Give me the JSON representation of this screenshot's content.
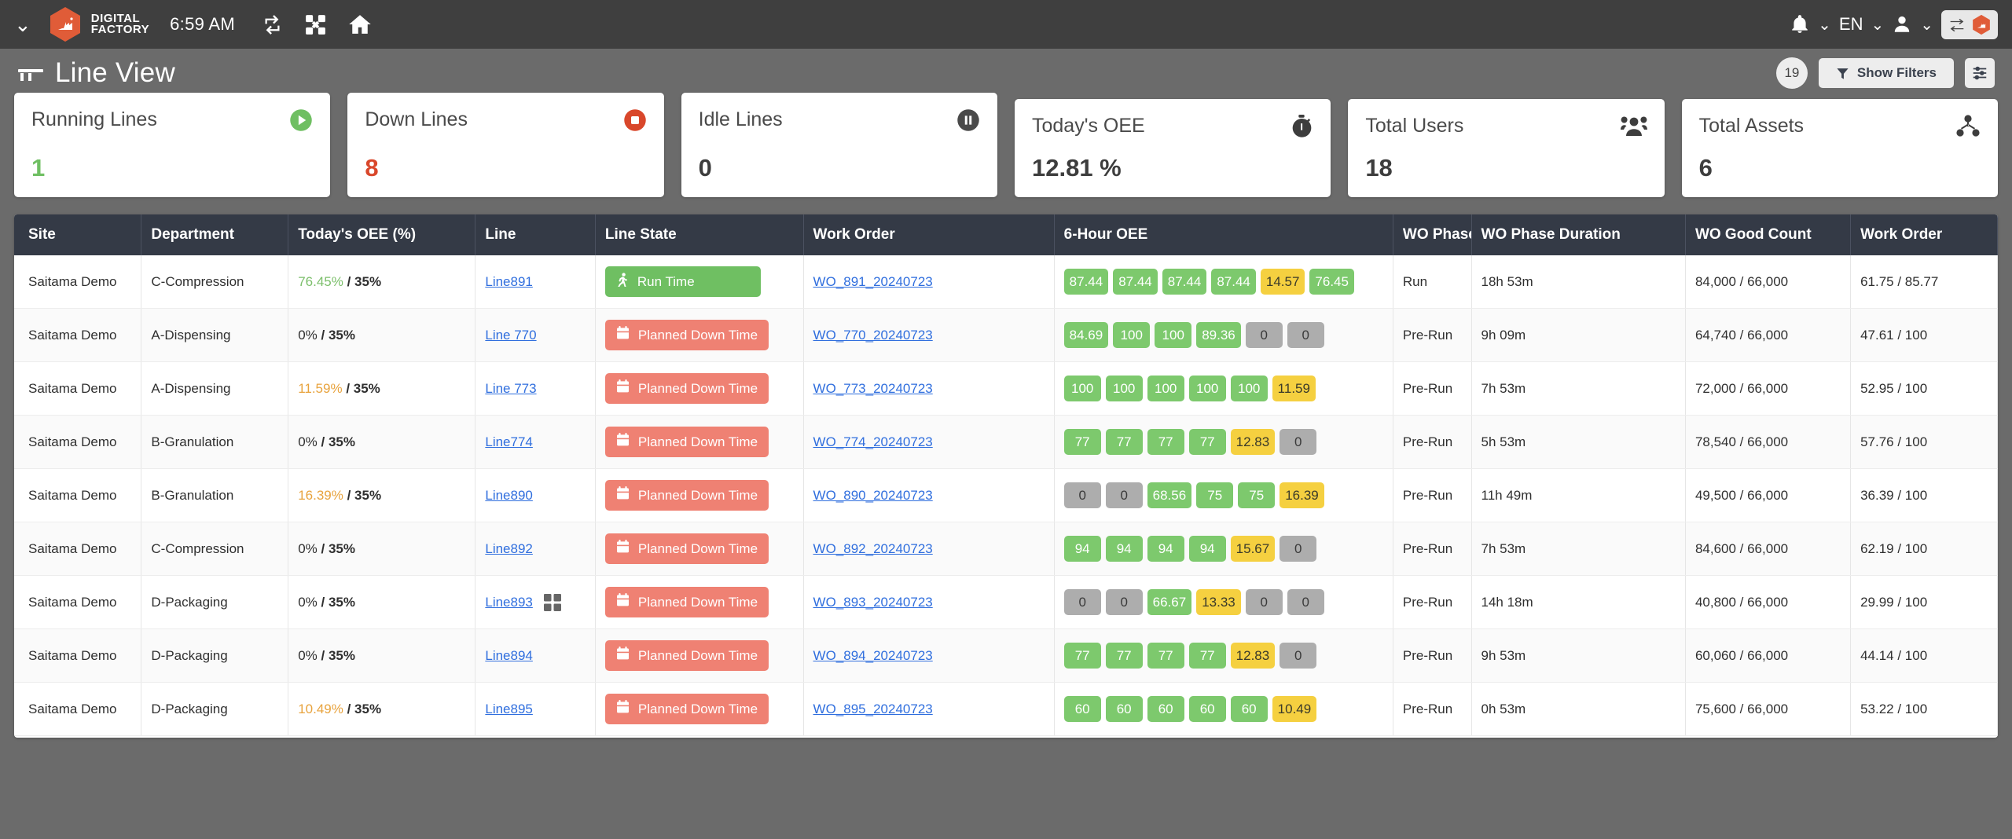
{
  "topnav": {
    "menu_chevron": "chevron-down",
    "brand_line1": "DIGITAL",
    "brand_line2": "FACTORY",
    "clock": "6:59 AM",
    "icons": [
      "refresh-icon",
      "expand-icon",
      "home-icon"
    ],
    "language": "EN",
    "notifications_icon": "bell-icon",
    "profile_icon": "user-icon",
    "switcher_icon": "swap-icon"
  },
  "page": {
    "title": "Line View",
    "title_icon": "line-view-icon",
    "count_badge": "19",
    "show_filters_label": "Show Filters",
    "filter_icon": "funnel-icon",
    "settings_icon": "sliders-icon"
  },
  "kpis": [
    {
      "title": "Running Lines",
      "value": "1",
      "icon": "play-circle-icon",
      "value_class": "green",
      "icon_color": "#6fbf62"
    },
    {
      "title": "Down Lines",
      "value": "8",
      "icon": "stop-circle-icon",
      "value_class": "red",
      "icon_color": "#d9472b"
    },
    {
      "title": "Idle Lines",
      "value": "0",
      "icon": "pause-circle-icon",
      "value_class": "",
      "icon_color": "#4a4a4a"
    },
    {
      "title": "Today's OEE",
      "value": "12.81 %",
      "icon": "stopwatch-icon",
      "value_class": "",
      "icon_color": "#3d3d3d"
    },
    {
      "title": "Total Users",
      "value": "18",
      "icon": "users-icon",
      "value_class": "",
      "icon_color": "#3d3d3d"
    },
    {
      "title": "Total Assets",
      "value": "6",
      "icon": "assets-icon",
      "value_class": "",
      "icon_color": "#3d3d3d"
    }
  ],
  "table": {
    "columns": [
      "Site",
      "Department",
      "Today's OEE (%)",
      "Line",
      "Line State",
      "Work Order",
      "6-Hour OEE",
      "WO Phase",
      "WO Phase Duration",
      "WO Good Count",
      "Work Order "
    ],
    "rows": [
      {
        "site": "Saitama Demo",
        "department": "C-Compression",
        "oee_value": "76.45%",
        "oee_class": "oee-good",
        "oee_target": "/ 35%",
        "line": "Line891",
        "has_grid_icon": false,
        "state": "Run Time",
        "state_type": "run",
        "state_icon": "runner-icon",
        "work_order": "WO_891_20240723",
        "oee6": [
          {
            "v": "87.44",
            "c": "b-green"
          },
          {
            "v": "87.44",
            "c": "b-green"
          },
          {
            "v": "87.44",
            "c": "b-green"
          },
          {
            "v": "87.44",
            "c": "b-green"
          },
          {
            "v": "14.57",
            "c": "b-yellow"
          },
          {
            "v": "76.45",
            "c": "b-green"
          }
        ],
        "phase": "Run",
        "duration": "18h 53m",
        "good_count": "84,000 / 66,000",
        "wo_last": "61.75 / 85.77"
      },
      {
        "site": "Saitama Demo",
        "department": "A-Dispensing",
        "oee_value": "0%",
        "oee_class": "oee-zero",
        "oee_target": "/ 35%",
        "line": "Line 770",
        "has_grid_icon": false,
        "state": "Planned Down Time",
        "state_type": "down",
        "state_icon": "calendar-icon",
        "work_order": "WO_770_20240723",
        "oee6": [
          {
            "v": "84.69",
            "c": "b-green"
          },
          {
            "v": "100",
            "c": "b-green"
          },
          {
            "v": "100",
            "c": "b-green"
          },
          {
            "v": "89.36",
            "c": "b-green"
          },
          {
            "v": "0",
            "c": "b-gray"
          },
          {
            "v": "0",
            "c": "b-gray"
          }
        ],
        "phase": "Pre-Run",
        "duration": "9h 09m",
        "good_count": "64,740 / 66,000",
        "wo_last": "47.61 / 100"
      },
      {
        "site": "Saitama Demo",
        "department": "A-Dispensing",
        "oee_value": "11.59%",
        "oee_class": "oee-warn",
        "oee_target": "/ 35%",
        "line": "Line 773",
        "has_grid_icon": false,
        "state": "Planned Down Time",
        "state_type": "down",
        "state_icon": "calendar-icon",
        "work_order": "WO_773_20240723",
        "oee6": [
          {
            "v": "100",
            "c": "b-green"
          },
          {
            "v": "100",
            "c": "b-green"
          },
          {
            "v": "100",
            "c": "b-green"
          },
          {
            "v": "100",
            "c": "b-green"
          },
          {
            "v": "100",
            "c": "b-green"
          },
          {
            "v": "11.59",
            "c": "b-yellow"
          }
        ],
        "phase": "Pre-Run",
        "duration": "7h 53m",
        "good_count": "72,000 / 66,000",
        "wo_last": "52.95 / 100"
      },
      {
        "site": "Saitama Demo",
        "department": "B-Granulation",
        "oee_value": "0%",
        "oee_class": "oee-zero",
        "oee_target": "/ 35%",
        "line": "Line774",
        "has_grid_icon": false,
        "state": "Planned Down Time",
        "state_type": "down",
        "state_icon": "calendar-icon",
        "work_order": "WO_774_20240723",
        "oee6": [
          {
            "v": "77",
            "c": "b-green"
          },
          {
            "v": "77",
            "c": "b-green"
          },
          {
            "v": "77",
            "c": "b-green"
          },
          {
            "v": "77",
            "c": "b-green"
          },
          {
            "v": "12.83",
            "c": "b-yellow"
          },
          {
            "v": "0",
            "c": "b-gray"
          }
        ],
        "phase": "Pre-Run",
        "duration": "5h 53m",
        "good_count": "78,540 / 66,000",
        "wo_last": "57.76 / 100"
      },
      {
        "site": "Saitama Demo",
        "department": "B-Granulation",
        "oee_value": "16.39%",
        "oee_class": "oee-warn",
        "oee_target": "/ 35%",
        "line": "Line890",
        "has_grid_icon": false,
        "state": "Planned Down Time",
        "state_type": "down",
        "state_icon": "calendar-icon",
        "work_order": "WO_890_20240723",
        "oee6": [
          {
            "v": "0",
            "c": "b-gray"
          },
          {
            "v": "0",
            "c": "b-gray"
          },
          {
            "v": "68.56",
            "c": "b-green"
          },
          {
            "v": "75",
            "c": "b-green"
          },
          {
            "v": "75",
            "c": "b-green"
          },
          {
            "v": "16.39",
            "c": "b-yellow"
          }
        ],
        "phase": "Pre-Run",
        "duration": "11h 49m",
        "good_count": "49,500 / 66,000",
        "wo_last": "36.39 / 100"
      },
      {
        "site": "Saitama Demo",
        "department": "C-Compression",
        "oee_value": "0%",
        "oee_class": "oee-zero",
        "oee_target": "/ 35%",
        "line": "Line892",
        "has_grid_icon": false,
        "state": "Planned Down Time",
        "state_type": "down",
        "state_icon": "calendar-icon",
        "work_order": "WO_892_20240723",
        "oee6": [
          {
            "v": "94",
            "c": "b-green"
          },
          {
            "v": "94",
            "c": "b-green"
          },
          {
            "v": "94",
            "c": "b-green"
          },
          {
            "v": "94",
            "c": "b-green"
          },
          {
            "v": "15.67",
            "c": "b-yellow"
          },
          {
            "v": "0",
            "c": "b-gray"
          }
        ],
        "phase": "Pre-Run",
        "duration": "7h 53m",
        "good_count": "84,600 / 66,000",
        "wo_last": "62.19 / 100"
      },
      {
        "site": "Saitama Demo",
        "department": "D-Packaging",
        "oee_value": "0%",
        "oee_class": "oee-zero",
        "oee_target": "/ 35%",
        "line": "Line893",
        "has_grid_icon": true,
        "state": "Planned Down Time",
        "state_type": "down",
        "state_icon": "calendar-icon",
        "work_order": "WO_893_20240723",
        "oee6": [
          {
            "v": "0",
            "c": "b-gray"
          },
          {
            "v": "0",
            "c": "b-gray"
          },
          {
            "v": "66.67",
            "c": "b-green"
          },
          {
            "v": "13.33",
            "c": "b-yellow"
          },
          {
            "v": "0",
            "c": "b-gray"
          },
          {
            "v": "0",
            "c": "b-gray"
          }
        ],
        "phase": "Pre-Run",
        "duration": "14h 18m",
        "good_count": "40,800 / 66,000",
        "wo_last": "29.99 / 100"
      },
      {
        "site": "Saitama Demo",
        "department": "D-Packaging",
        "oee_value": "0%",
        "oee_class": "oee-zero",
        "oee_target": "/ 35%",
        "line": "Line894",
        "has_grid_icon": false,
        "state": "Planned Down Time",
        "state_type": "down",
        "state_icon": "calendar-icon",
        "work_order": "WO_894_20240723",
        "oee6": [
          {
            "v": "77",
            "c": "b-green"
          },
          {
            "v": "77",
            "c": "b-green"
          },
          {
            "v": "77",
            "c": "b-green"
          },
          {
            "v": "77",
            "c": "b-green"
          },
          {
            "v": "12.83",
            "c": "b-yellow"
          },
          {
            "v": "0",
            "c": "b-gray"
          }
        ],
        "phase": "Pre-Run",
        "duration": "9h 53m",
        "good_count": "60,060 / 66,000",
        "wo_last": "44.14 / 100"
      },
      {
        "site": "Saitama Demo",
        "department": "D-Packaging",
        "oee_value": "10.49%",
        "oee_class": "oee-warn",
        "oee_target": "/ 35%",
        "line": "Line895",
        "has_grid_icon": false,
        "state": "Planned Down Time",
        "state_type": "down",
        "state_icon": "calendar-icon",
        "work_order": "WO_895_20240723",
        "oee6": [
          {
            "v": "60",
            "c": "b-green"
          },
          {
            "v": "60",
            "c": "b-green"
          },
          {
            "v": "60",
            "c": "b-green"
          },
          {
            "v": "60",
            "c": "b-green"
          },
          {
            "v": "60",
            "c": "b-green"
          },
          {
            "v": "10.49",
            "c": "b-yellow"
          }
        ],
        "phase": "Pre-Run",
        "duration": "0h 53m",
        "good_count": "75,600 / 66,000",
        "wo_last": "53.22 / 100"
      }
    ]
  }
}
